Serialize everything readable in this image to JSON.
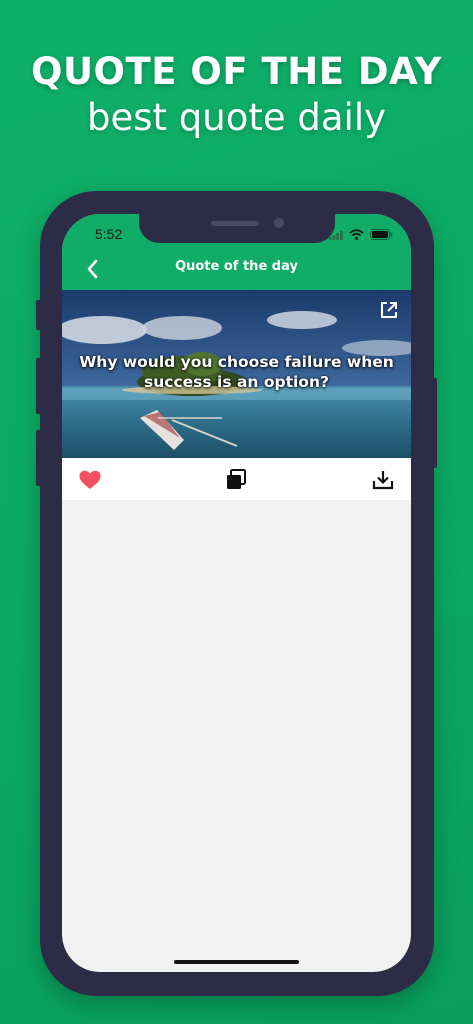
{
  "promo": {
    "title": "QUOTE OF THE DAY",
    "subtitle": "best quote daily"
  },
  "status_bar": {
    "time": "5:52",
    "icons": [
      "signal-icon",
      "wifi-icon",
      "battery-icon"
    ]
  },
  "nav": {
    "title": "Quote of the day",
    "back_icon": "chevron-left-icon"
  },
  "quote": {
    "text": "Why would you choose failure when success is an option?",
    "background": "tropical-island-photo",
    "open_icon": "open-external-icon"
  },
  "actions": {
    "items": [
      "heart-icon",
      "copy-icon",
      "download-icon"
    ],
    "favorite_color": "#f25061"
  },
  "colors": {
    "brand_green": "#0fad67",
    "frame": "#2d2c46",
    "content_bg": "#f2f1f2"
  }
}
